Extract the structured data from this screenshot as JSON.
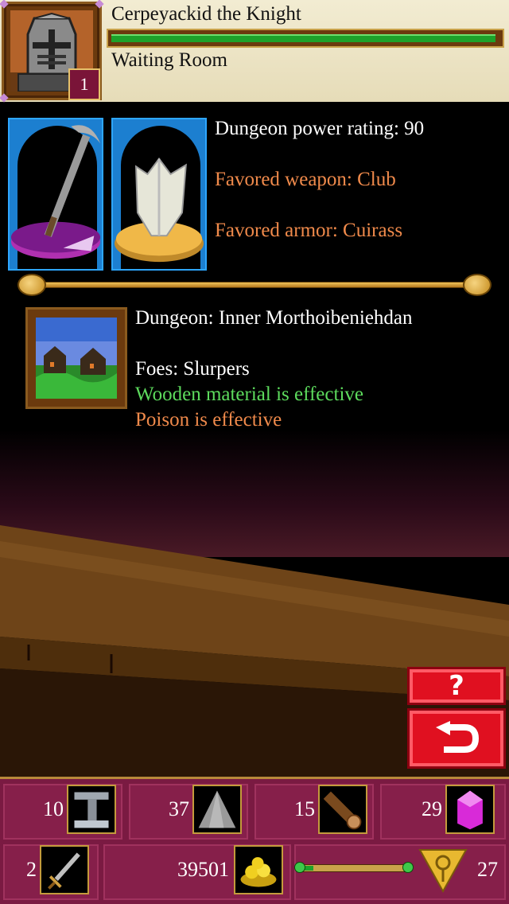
{
  "hero": {
    "name": "Cerpeyackid the Knight",
    "level": "1",
    "location": "Waiting Room",
    "health_fraction": 0.99
  },
  "equipment": {
    "weapon_icon": "scythe-icon",
    "armor_icon": "cuirass-icon",
    "power_rating": "Dungeon power rating: 90",
    "favored_weapon": "Favored weapon: Club",
    "favored_armor": "Favored armor: Cuirass"
  },
  "dungeon": {
    "name": "Dungeon: Inner Morthoibeniehdan",
    "foes": "Foes: Slurpers",
    "weakness_1": "Wooden material is effective",
    "weakness_2": "Poison is effective"
  },
  "buttons": {
    "help_label": "?",
    "back_icon": "return-arrow-icon"
  },
  "inventory": {
    "iron": "10",
    "stone": "37",
    "wood": "15",
    "crystal": "29",
    "swords": "2",
    "gold": "39501",
    "experience_fraction": 0.12,
    "rank": "27"
  },
  "colors": {
    "header_bg": "#f2ecd2",
    "health": "#1da22a",
    "favored_text": "#f08a4b",
    "effective_text": "#5ddb5d",
    "inventory_bg": "#7a1a42",
    "button_red": "#e01020"
  }
}
